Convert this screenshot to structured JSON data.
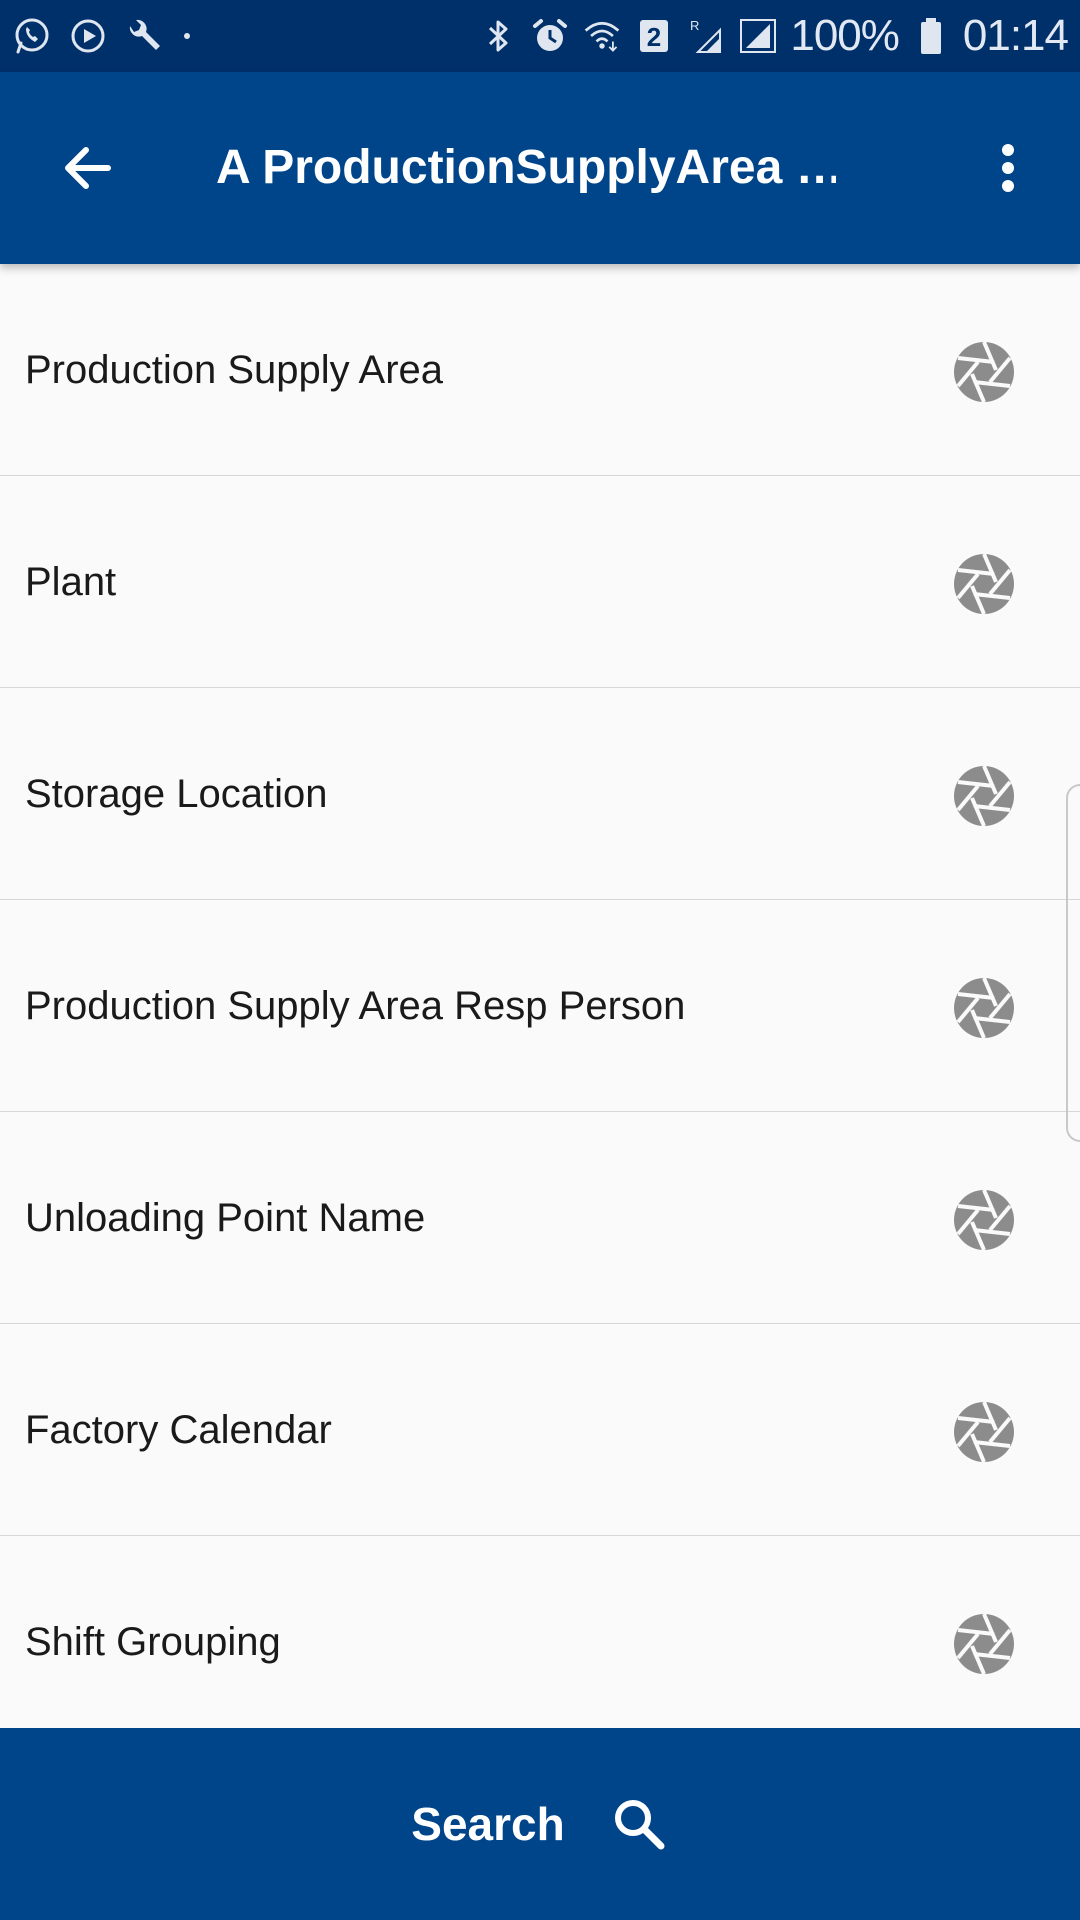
{
  "status_bar": {
    "icons_left": [
      "whatsapp-icon",
      "play-circle-icon",
      "wrench-icon",
      "dot-icon"
    ],
    "icons_right": [
      "bluetooth-icon",
      "alarm-icon",
      "wifi-icon",
      "sim-2-badge-icon",
      "roaming-signal-icon",
      "signal-icon",
      "battery-icon"
    ],
    "sim_badge": "2",
    "battery_percent": "100%",
    "time": "01:14"
  },
  "app_bar": {
    "title": "A ProductionSupplyArea …",
    "back_icon": "arrow-left-icon",
    "menu_icon": "more-vert-icon"
  },
  "list": {
    "items": [
      {
        "label": "Production Supply Area",
        "icon": "aperture-icon"
      },
      {
        "label": "Plant",
        "icon": "aperture-icon"
      },
      {
        "label": "Storage Location",
        "icon": "aperture-icon"
      },
      {
        "label": "Production Supply Area Resp Person",
        "icon": "aperture-icon"
      },
      {
        "label": "Unloading Point Name",
        "icon": "aperture-icon"
      },
      {
        "label": "Factory Calendar",
        "icon": "aperture-icon"
      },
      {
        "label": "Shift Grouping",
        "icon": "aperture-icon"
      }
    ]
  },
  "search_bar": {
    "label": "Search",
    "icon": "search-icon"
  },
  "colors": {
    "status_bar_bg": "#00306a",
    "app_bar_bg": "#00448a",
    "list_bg": "#fafafa",
    "divider": "#d6d6d6",
    "icon_gray": "#8c8c8c",
    "text": "#1a1a1a",
    "on_primary": "#ffffff"
  }
}
